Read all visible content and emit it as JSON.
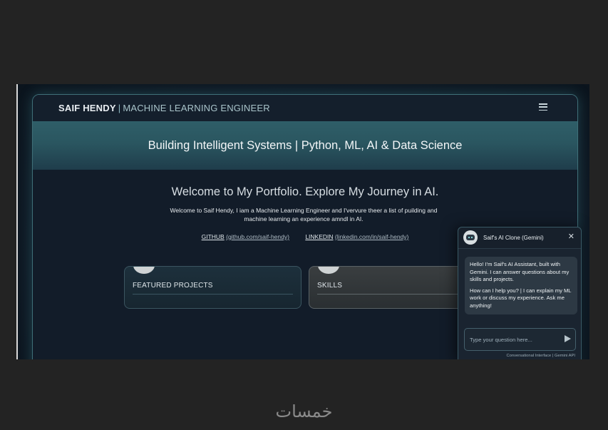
{
  "nav": {
    "brand_name": "SAIF HENDY",
    "brand_separator": "|",
    "brand_role": "MACHINE LEARNING ENGINEER",
    "menu_icon": "hamburger-menu-icon"
  },
  "hero": {
    "tagline": "Building Intelligent Systems | Python, ML, AI & Data Science"
  },
  "main": {
    "welcome_title": "Welcome to My Portfolio. Explore My Journey in AI.",
    "intro_line1": "Welcome to Saif Hendy, I iam a Machine Learning Engineer and I'vervure theer a list of puilding and",
    "intro_line2": "machine learning an experience amndl in AI.",
    "github_label": "GITHUB",
    "github_url": "(github.com/saif-hendy)",
    "linkedin_label": "LINKEDIN",
    "linkedin_url": "(linkedin.com/in/saif-hendy)"
  },
  "cards": [
    {
      "title": "FEATURED PROJECTS"
    },
    {
      "title": "SKILLS"
    }
  ],
  "chat": {
    "title": "Saif's AI Clone (Gemini)",
    "close_icon": "close-icon",
    "message_p1": "Hello! I'm Saif's AI Assistant, built with Gemini. I can answer questions about my skills and projects.",
    "message_p2": "How can I help you? | I can explain my ML work or discuss my experience. Ask me anything!",
    "input_placeholder": "Type your question here...",
    "send_icon": "send-icon",
    "footer": "Conversational Interface | Gemini API"
  },
  "watermark": "خمسات",
  "colors": {
    "hero_teal": "#2f5e68",
    "page_dark": "#121c29",
    "frame_border": "#3f6f78",
    "outer_background": "#232323"
  }
}
